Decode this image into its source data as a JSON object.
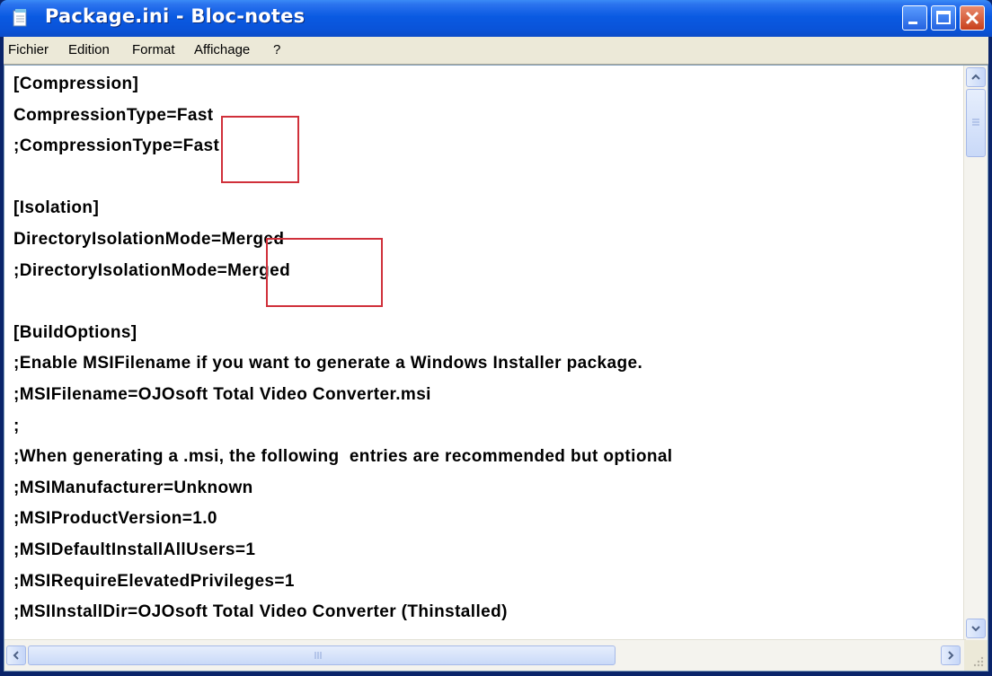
{
  "window": {
    "title": "Package.ini - Bloc-notes"
  },
  "menu": {
    "items": [
      "Fichier",
      "Edition",
      "Format",
      "Affichage",
      "?"
    ]
  },
  "editor": {
    "lines": [
      "[Compression]",
      "CompressionType=Fast",
      ";CompressionType=Fast",
      "",
      "[Isolation]",
      "DirectoryIsolationMode=Merged",
      ";DirectoryIsolationMode=Merged",
      "",
      "[BuildOptions]",
      ";Enable MSIFilename if you want to generate a Windows Installer package.",
      ";MSIFilename=OJOsoft Total Video Converter.msi",
      ";",
      ";When generating a .msi, the following  entries are recommended but optional",
      ";MSIManufacturer=Unknown",
      ";MSIProductVersion=1.0",
      ";MSIDefaultInstallAllUsers=1",
      ";MSIRequireElevatedPrivileges=1",
      ";MSIInstallDir=OJOsoft Total Video Converter (Thinstalled)"
    ]
  },
  "colors": {
    "highlight": "#d0303a",
    "titlebar": "#0a5ae2"
  },
  "icons": {
    "app": "notepad-icon",
    "minimize": "minimize-icon",
    "maximize": "maximize-icon",
    "close": "close-icon"
  }
}
